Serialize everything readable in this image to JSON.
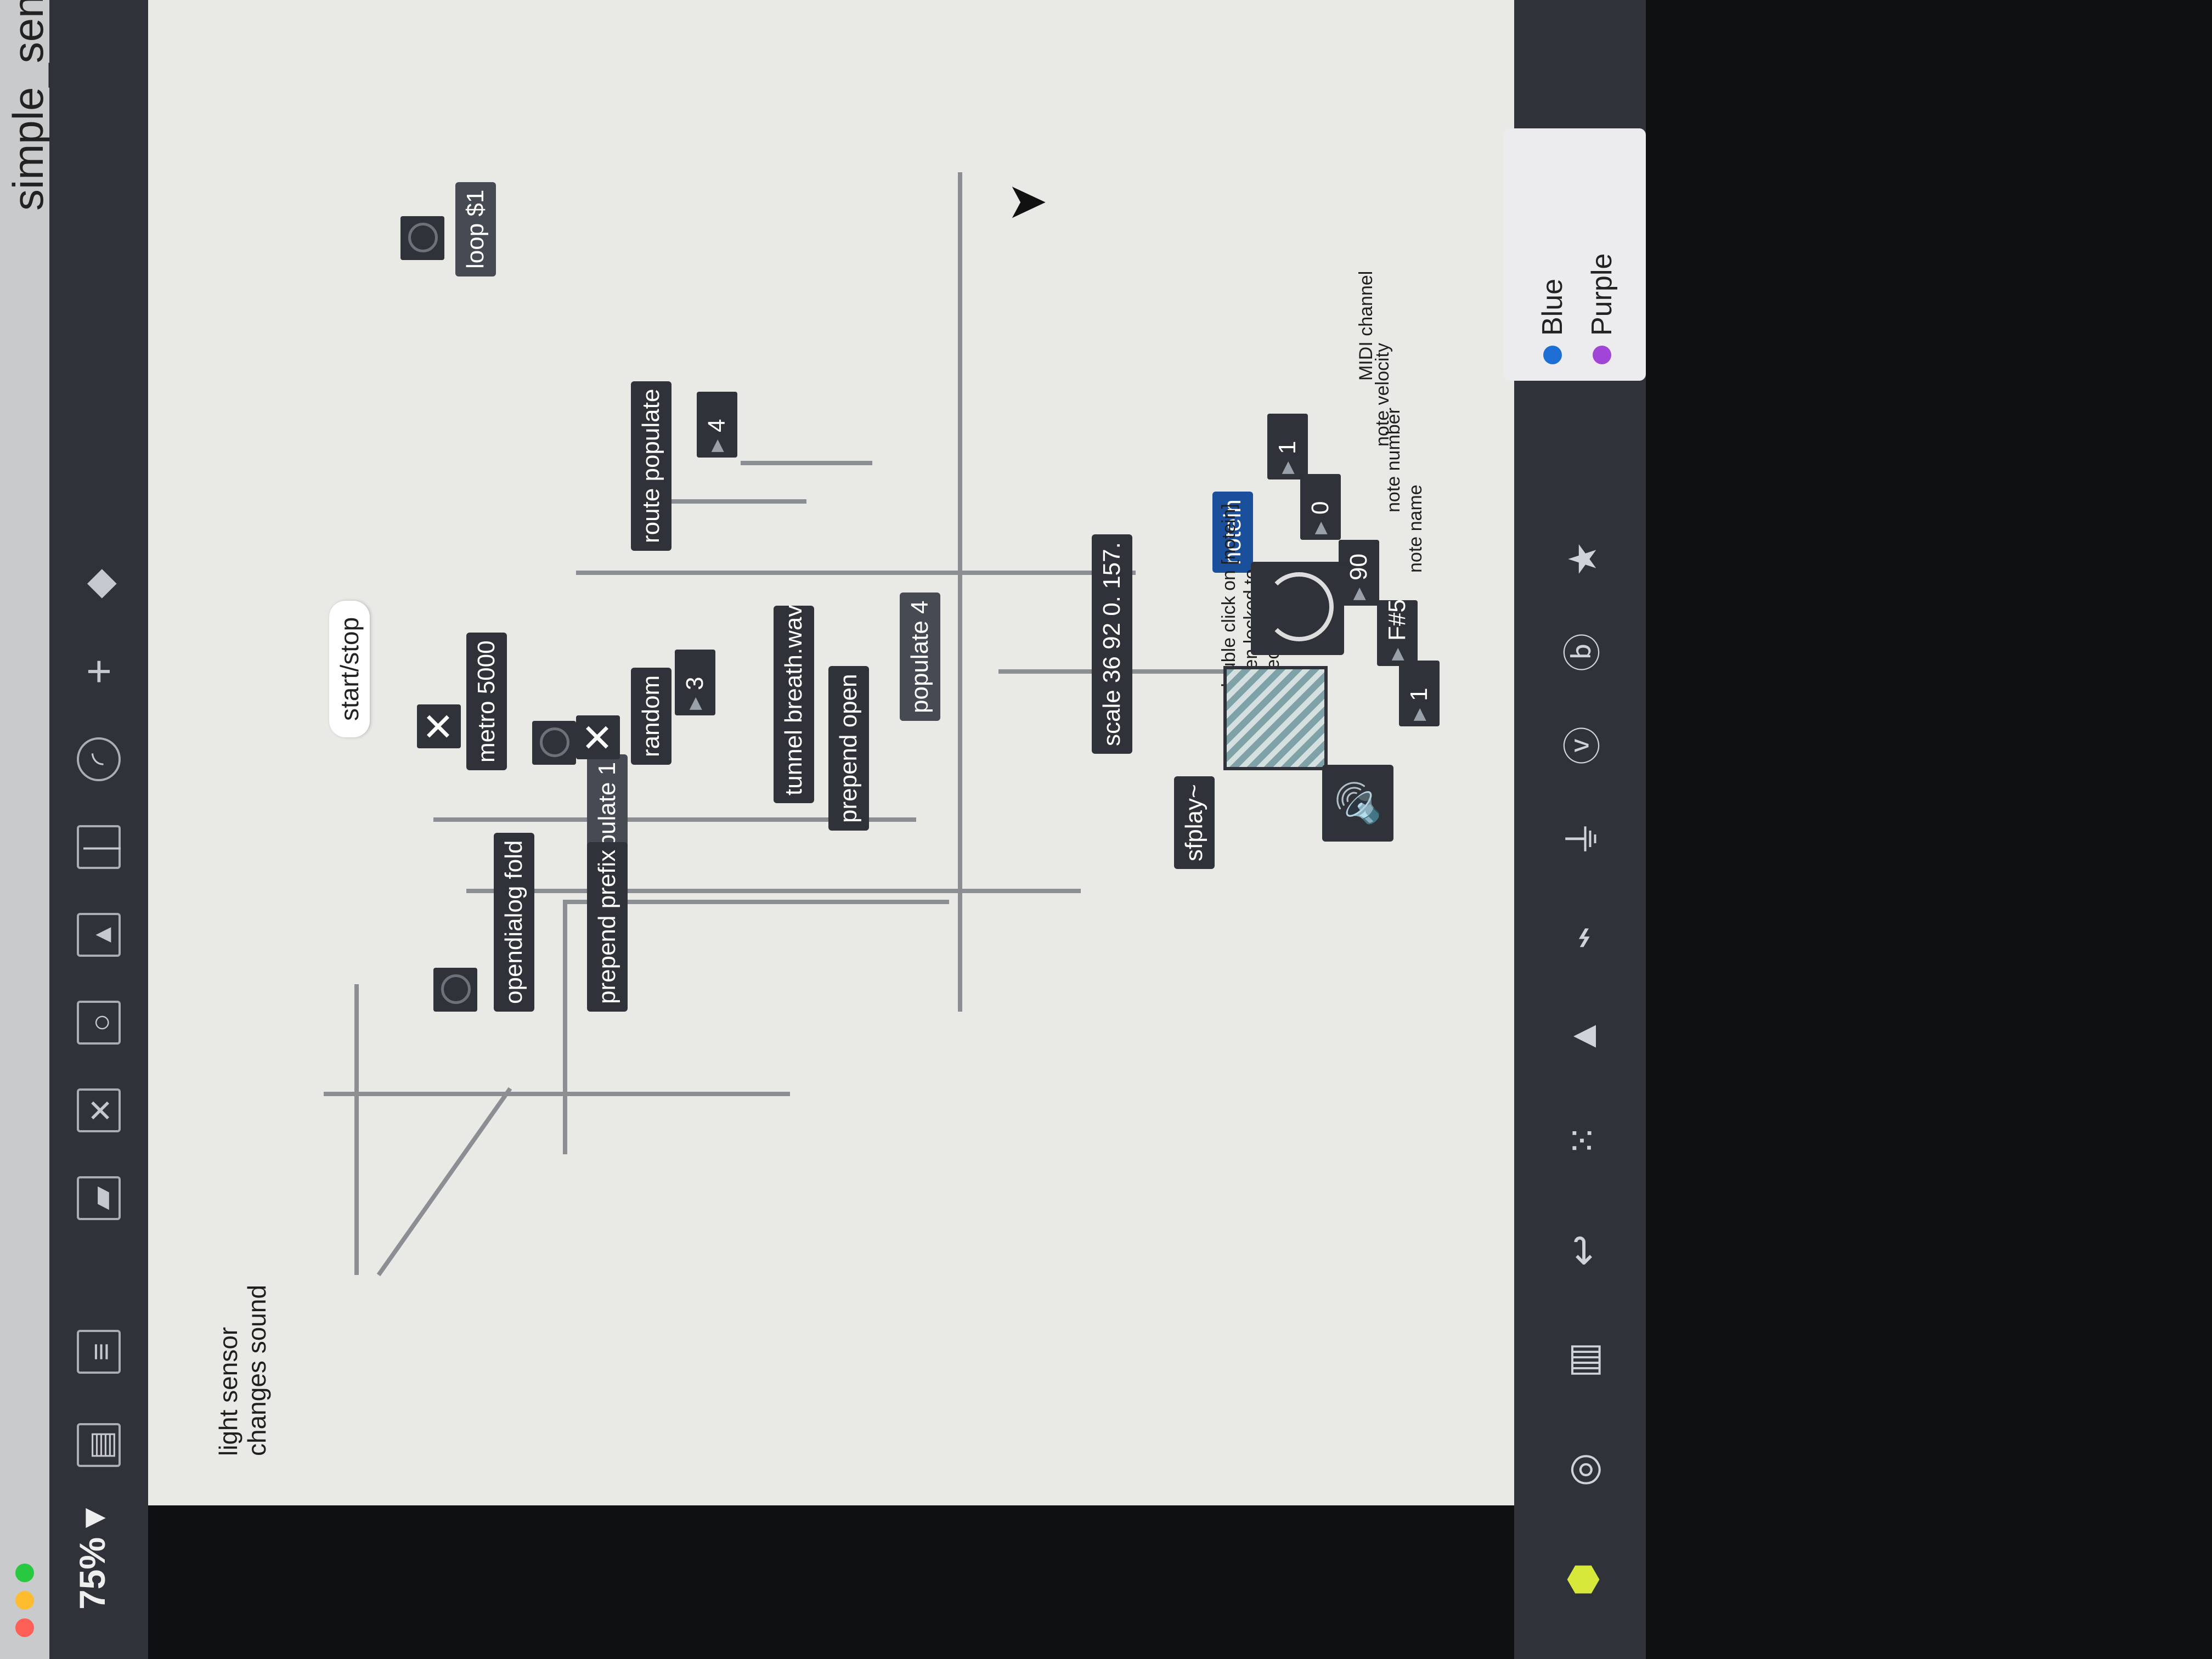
{
  "window": {
    "title": "simple_senso",
    "zoom": "75% ▾"
  },
  "patch": {
    "comment_main": "light sensor\nchanges sound",
    "bubble_start": "start/stop",
    "metro": "metro 5000",
    "loop": "loop $1",
    "opendialog": "opendialog fold",
    "autopopulate": "autopopulate 1",
    "prepend_prefix": "prepend prefix",
    "random": "random",
    "route_populate": "route populate",
    "num_3": "3",
    "num_4": "4",
    "umenu": "tunnel breath.wav",
    "prepend_open": "prepend open",
    "populate": "populate 4",
    "scale": "scale 36 92 0. 157.",
    "sfplay": "sfplay~",
    "notein": "notein",
    "comment_notein": "double click on [notein]\nwhen locked to\nselect usb port",
    "num_channel": "1",
    "num_velocity": "0",
    "num_number": "90",
    "note_name": "F#5",
    "num_dial": "1",
    "label_channel": "MIDI channel",
    "label_velocity": "note velocity",
    "label_number": "note number",
    "label_name": "note name"
  },
  "color_panel": {
    "items": [
      {
        "label": "Blue",
        "color": "#1d6fd6"
      },
      {
        "label": "Purple",
        "color": "#a145d6"
      }
    ]
  },
  "icons": {
    "toolbar": [
      "lock-icon",
      "copy-icon",
      "presentation-icon",
      "new-object-icon",
      "toggle-icon",
      "dial-icon",
      "slider-icon",
      "number-icon",
      "add-icon",
      "tag-icon"
    ],
    "sidebar": [
      "cube-icon",
      "target-icon",
      "layout-icon",
      "snippet-icon",
      "grid-icon",
      "picture-icon",
      "paperclip-icon",
      "plug-icon",
      "v-icon",
      "b-icon",
      "star-icon"
    ]
  }
}
